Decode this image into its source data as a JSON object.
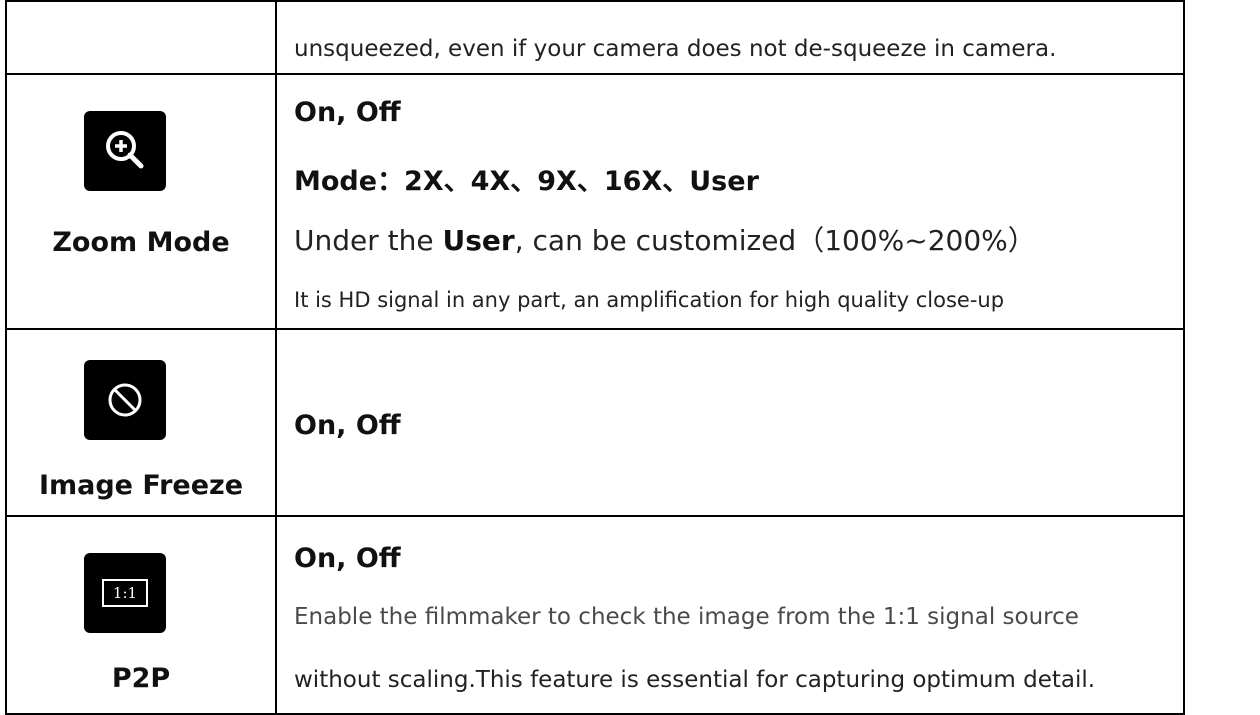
{
  "row_continuation": {
    "text": "unsqueezed, even if your camera does not de-squeeze in camera."
  },
  "zoom_mode": {
    "label": "Zoom Mode",
    "icon": "zoom-in-icon",
    "line1": "On, Off",
    "line2": "Mode：2X、4X、9X、16X、User",
    "line3_prefix": "Under the ",
    "line3_bold": "User",
    "line3_suffix": ", can be customized（100%~200%）",
    "line4": "It is HD signal in any part, an amplification for high quality close-up"
  },
  "image_freeze": {
    "label": "Image Freeze",
    "icon": "freeze-icon",
    "line1": "On, Off"
  },
  "p2p": {
    "label": "P2P",
    "icon": "one-to-one-icon",
    "icon_text": "1:1",
    "line1": "On, Off",
    "line2": "Enable the filmmaker to check the image from the 1:1 signal source",
    "line3": "without scaling.This feature is essential for capturing optimum detail."
  }
}
